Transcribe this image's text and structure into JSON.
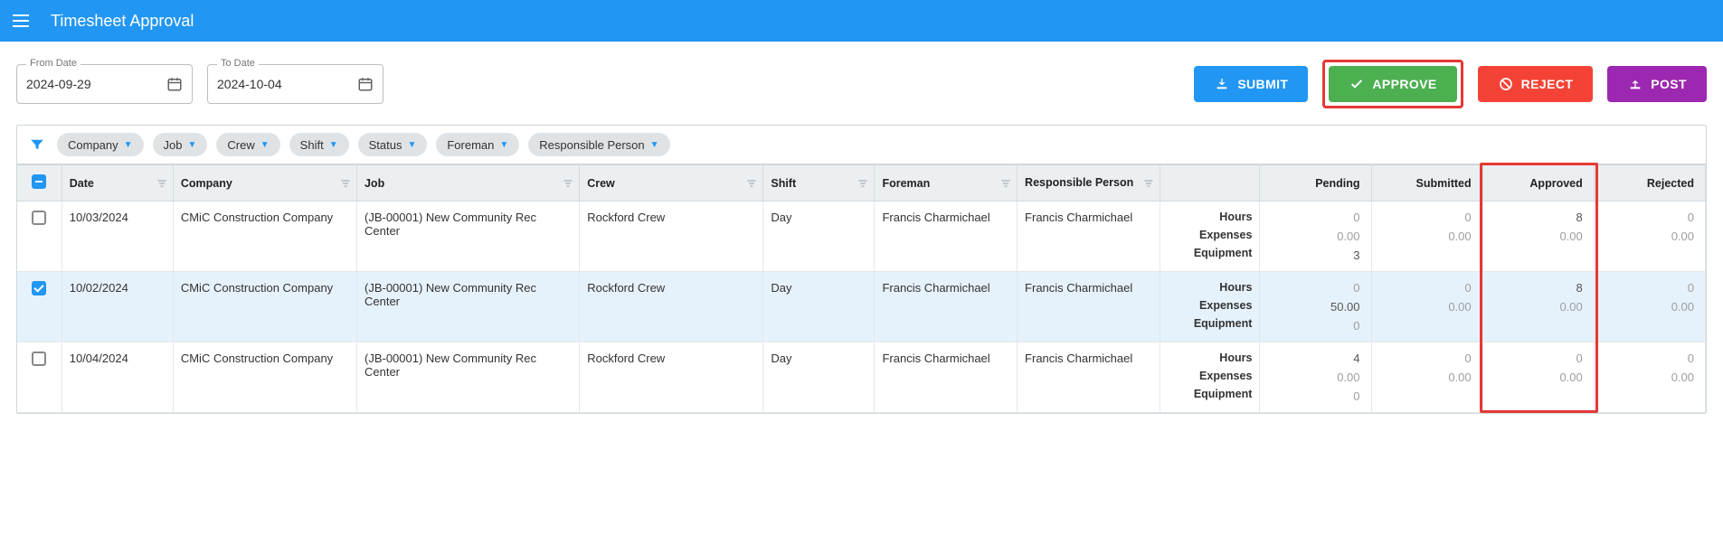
{
  "header": {
    "title": "Timesheet Approval"
  },
  "filters": {
    "from_date_label": "From Date",
    "from_date_value": "2024-09-29",
    "to_date_label": "To Date",
    "to_date_value": "2024-10-04"
  },
  "buttons": {
    "submit": "SUBMIT",
    "approve": "APPROVE",
    "reject": "REJECT",
    "post": "POST"
  },
  "chips": {
    "company": "Company",
    "job": "Job",
    "crew": "Crew",
    "shift": "Shift",
    "status": "Status",
    "foreman": "Foreman",
    "responsible": "Responsible Person"
  },
  "columns": {
    "date": "Date",
    "company": "Company",
    "job": "Job",
    "crew": "Crew",
    "shift": "Shift",
    "foreman": "Foreman",
    "responsible": "Responsible Person",
    "pending": "Pending",
    "submitted": "Submitted",
    "approved": "Approved",
    "rejected": "Rejected"
  },
  "metric_labels": {
    "hours": "Hours",
    "expenses": "Expenses",
    "equipment": "Equipment"
  },
  "rows": [
    {
      "checked": false,
      "date": "10/03/2024",
      "company": "CMiC Construction Company",
      "job": "(JB-00001) New Community Rec Center",
      "crew": "Rockford Crew",
      "shift": "Day",
      "foreman": "Francis Charmichael",
      "responsible": "Francis Charmichael",
      "pending": {
        "hours": "0",
        "expenses": "0.00",
        "equipment": "3"
      },
      "submitted": {
        "hours": "0",
        "expenses": "0.00",
        "equipment": ""
      },
      "approved": {
        "hours": "8",
        "expenses": "0.00",
        "equipment": ""
      },
      "rejected": {
        "hours": "0",
        "expenses": "0.00",
        "equipment": ""
      }
    },
    {
      "checked": true,
      "date": "10/02/2024",
      "company": "CMiC Construction Company",
      "job": "(JB-00001) New Community Rec Center",
      "crew": "Rockford Crew",
      "shift": "Day",
      "foreman": "Francis Charmichael",
      "responsible": "Francis Charmichael",
      "pending": {
        "hours": "0",
        "expenses": "50.00",
        "equipment": "0"
      },
      "submitted": {
        "hours": "0",
        "expenses": "0.00",
        "equipment": ""
      },
      "approved": {
        "hours": "8",
        "expenses": "0.00",
        "equipment": ""
      },
      "rejected": {
        "hours": "0",
        "expenses": "0.00",
        "equipment": ""
      }
    },
    {
      "checked": false,
      "date": "10/04/2024",
      "company": "CMiC Construction Company",
      "job": "(JB-00001) New Community Rec Center",
      "crew": "Rockford Crew",
      "shift": "Day",
      "foreman": "Francis Charmichael",
      "responsible": "Francis Charmichael",
      "pending": {
        "hours": "4",
        "expenses": "0.00",
        "equipment": "0"
      },
      "submitted": {
        "hours": "0",
        "expenses": "0.00",
        "equipment": ""
      },
      "approved": {
        "hours": "0",
        "expenses": "0.00",
        "equipment": ""
      },
      "rejected": {
        "hours": "0",
        "expenses": "0.00",
        "equipment": ""
      }
    }
  ]
}
